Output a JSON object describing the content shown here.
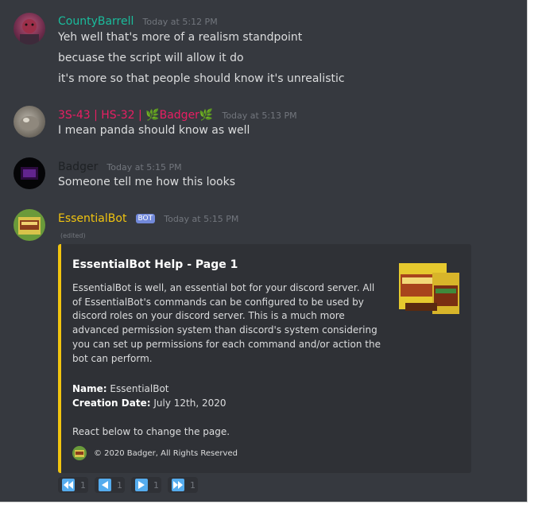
{
  "messages": [
    {
      "username": "CountyBarrell",
      "username_color": "#1abc9c",
      "timestamp": "Today at 5:12 PM",
      "lines": [
        "Yeh well that's more of a realism standpoint",
        "becuase the script will allow it do",
        "it's more so that people should know it's unrealistic"
      ]
    },
    {
      "username": "3S-43 | HS-32 | 🌿Badger🌿",
      "username_color": "#e91e63",
      "timestamp": "Today at 5:13 PM",
      "lines": [
        "I mean panda should know as well"
      ]
    },
    {
      "username": "Badger",
      "username_color": "#1e2124",
      "timestamp": "Today at 5:15 PM",
      "lines": [
        "Someone tell me how this looks"
      ]
    },
    {
      "username": "EssentialBot",
      "username_color": "#f1c40f",
      "bot_tag": "BOT",
      "timestamp": "Today at 5:15 PM",
      "edited": "(edited)"
    }
  ],
  "embed": {
    "title": "EssentialBot Help - Page 1",
    "description": "EssentialBot is well, an essential bot for your discord server. All of EssentialBot's commands can be configured to be used by discord roles on your discord server. This is a much more advanced permission system than discord's system considering you can set up permissions for each command and/or action the bot can perform.",
    "fields": [
      {
        "name": "Name:",
        "value": "EssentialBot"
      },
      {
        "name": "Creation Date:",
        "value": "July 12th, 2020"
      }
    ],
    "react_text": "React below to change the page.",
    "footer": "© 2020 Badger, All Rights Reserved",
    "accent_color": "#f1c40f"
  },
  "reactions": [
    {
      "icon": "rewind-icon",
      "count": "1"
    },
    {
      "icon": "previous-icon",
      "count": "1"
    },
    {
      "icon": "play-icon",
      "count": "1"
    },
    {
      "icon": "fast-forward-icon",
      "count": "1"
    }
  ]
}
